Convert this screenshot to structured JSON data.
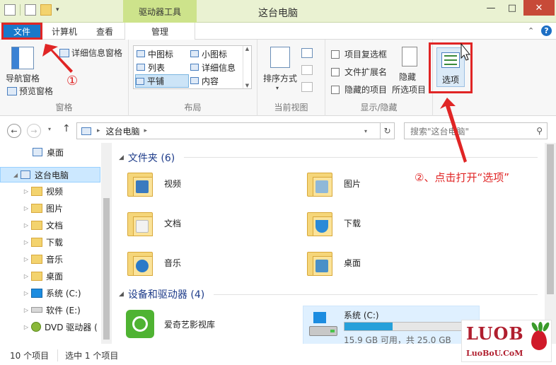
{
  "window": {
    "title": "这台电脑",
    "context_tab": "驱动器工具",
    "minimize": "—",
    "maximize": "□",
    "close": "✕"
  },
  "tabs": {
    "file": "文件",
    "computer": "计算机",
    "view": "查看",
    "manage": "管理"
  },
  "ribbon": {
    "panes": {
      "nav_pane": "导航窗格",
      "preview_pane": "预览窗格",
      "details_pane": "详细信息窗格",
      "label": "窗格"
    },
    "layout": {
      "items": [
        "中图标",
        "小图标",
        "列表",
        "详细信息",
        "平铺",
        "内容"
      ],
      "selected": "平铺",
      "label": "布局"
    },
    "current_view": {
      "sort_by": "排序方式",
      "label": "当前视图"
    },
    "show_hide": {
      "item_checkboxes": "项目复选框",
      "file_extensions": "文件扩展名",
      "hidden_items": "隐藏的项目",
      "hide_selected_line1": "隐藏",
      "hide_selected_line2": "所选项目",
      "label": "显示/隐藏"
    },
    "options": "选项"
  },
  "navbar": {
    "path_root": "这台电脑",
    "search_placeholder": "搜索\"这台电脑\""
  },
  "sidebar": {
    "items": [
      {
        "label": "桌面"
      },
      {
        "label": "这台电脑"
      },
      {
        "label": "视频"
      },
      {
        "label": "图片"
      },
      {
        "label": "文档"
      },
      {
        "label": "下载"
      },
      {
        "label": "音乐"
      },
      {
        "label": "桌面"
      },
      {
        "label": "系统 (C:)"
      },
      {
        "label": "软件 (E:)"
      },
      {
        "label": "DVD 驱动器 ("
      }
    ]
  },
  "content": {
    "folders_header": "文件夹 (6)",
    "folders": [
      "视频",
      "图片",
      "文档",
      "下载",
      "音乐",
      "桌面"
    ],
    "devices_header": "设备和驱动器 (4)",
    "device_app": "爱奇艺影视库",
    "drive": {
      "name": "系统 (C:)",
      "space": "15.9 GB 可用，共 25.0 GB",
      "used_fraction": 0.364
    }
  },
  "status": {
    "count": "10 个项目",
    "selected": "选中 1 个项目"
  },
  "annotations": {
    "step1": "①",
    "step2": "②、点击打开“选项”"
  },
  "logo": {
    "main": "LUOB",
    "sub": "LuoBoU.CoM"
  },
  "colors": {
    "file_tab": "#1979ca",
    "annotation_red": "#e02525",
    "context_tab": "#cde38b",
    "drive_bar": "#26a0da"
  }
}
